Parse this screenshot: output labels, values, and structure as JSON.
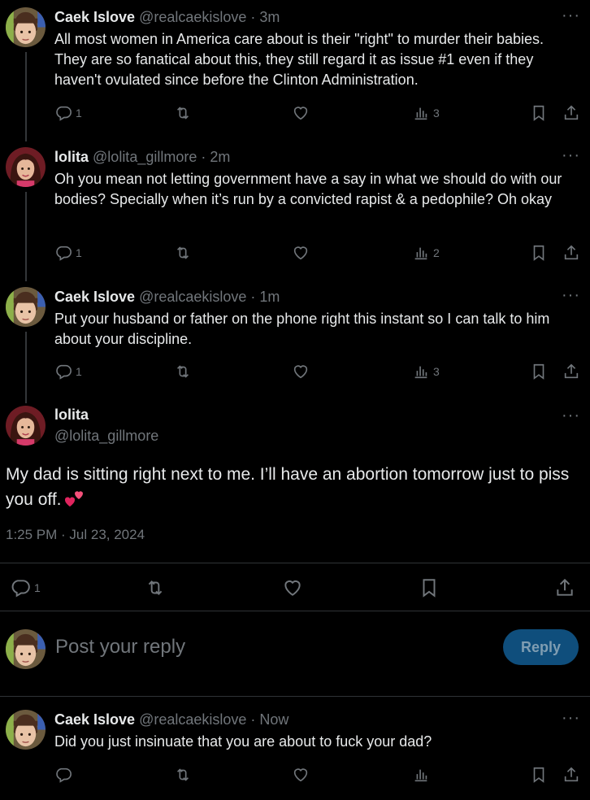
{
  "tweets": [
    {
      "name": "Caek Islove",
      "handle": "@realcaekislove · 3m",
      "text": "All most women in America care about is their \"right\" to murder their babies. They are so fanatical about this, they still regard it as issue #1 even if they haven't ovulated since before the Clinton Administration.",
      "replies": "1",
      "views": "3"
    },
    {
      "name": "lolita",
      "handle": "@lolita_gillmore · 2m",
      "text": "Oh you mean not letting government have a say in what we should do with our bodies? Specially when it’s run by a convicted rapist & a pedophile? Oh okay",
      "replies": "1",
      "views": "2"
    },
    {
      "name": "Caek Islove",
      "handle": "@realcaekislove · 1m",
      "text": "Put your husband or father on the phone right this instant so I can talk to him about your discipline.",
      "replies": "1",
      "views": "3"
    }
  ],
  "main_tweet": {
    "name": "lolita",
    "handle": "@lolita_gillmore",
    "text": "My dad is sitting right next to me. I’ll have an abortion tomorrow just to piss you off.",
    "timestamp": "1:25 PM · Jul 23, 2024",
    "replies": "1"
  },
  "reply_box": {
    "placeholder": "Post your reply",
    "button": "Reply"
  },
  "reply_tweet": {
    "name": "Caek Islove",
    "handle": "@realcaekislove · Now",
    "text": "Did you just insinuate that you are about to fuck your dad?"
  },
  "more_glyph": "···",
  "colors": {
    "background": "#000000",
    "text": "#e7e9ea",
    "muted": "#71767b",
    "divider": "#2f3336",
    "reply_button": "#0f4e7c"
  }
}
